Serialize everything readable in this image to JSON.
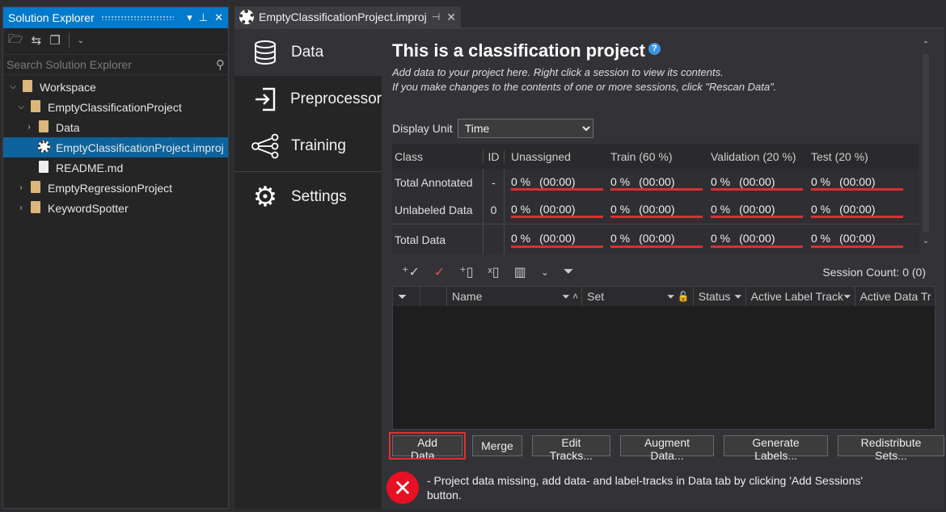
{
  "solution_explorer": {
    "title": "Solution Explorer",
    "search_placeholder": "Search Solution Explorer",
    "tree": [
      {
        "label": "Workspace",
        "depth": 0,
        "expanded": true,
        "kind": "folder"
      },
      {
        "label": "EmptyClassificationProject",
        "depth": 1,
        "expanded": true,
        "kind": "folder"
      },
      {
        "label": "Data",
        "depth": 2,
        "expanded": false,
        "kind": "folder"
      },
      {
        "label": "EmptyClassificationProject.improj",
        "depth": 2,
        "kind": "project",
        "selected": true
      },
      {
        "label": "README.md",
        "depth": 2,
        "kind": "file"
      },
      {
        "label": "EmptyRegressionProject",
        "depth": 1,
        "expanded": false,
        "kind": "folder"
      },
      {
        "label": "KeywordSpotter",
        "depth": 1,
        "expanded": false,
        "kind": "folder"
      }
    ]
  },
  "doc_tab": {
    "label": "EmptyClassificationProject.improj"
  },
  "nav": {
    "items": [
      {
        "label": "Data",
        "icon": "database-icon",
        "active": true
      },
      {
        "label": "Preprocessor",
        "icon": "import-icon"
      },
      {
        "label": "Training",
        "icon": "neural-network-icon"
      },
      {
        "label": "Settings",
        "icon": "gear-icon"
      }
    ]
  },
  "main": {
    "title": "This is a classification project",
    "desc1": "Add data to your project here. Right click a session to view its contents.",
    "desc2": "If you make changes to the contents of one or more sessions, click \"Rescan Data\".",
    "display_unit_label": "Display Unit",
    "display_unit_value": "Time"
  },
  "summary": {
    "headers": [
      "Class",
      "ID",
      "Unassigned",
      "Train (60 %)",
      "Validation (20 %)",
      "Test (20 %)"
    ],
    "rows": [
      {
        "class": "Total Annotated",
        "id": "-",
        "cells": [
          [
            "0 %",
            "(00:00)"
          ],
          [
            "0 %",
            "(00:00)"
          ],
          [
            "0 %",
            "(00:00)"
          ],
          [
            "0 %",
            "(00:00)"
          ]
        ]
      },
      {
        "class": "Unlabeled Data",
        "id": "0",
        "cells": [
          [
            "0 %",
            "(00:00)"
          ],
          [
            "0 %",
            "(00:00)"
          ],
          [
            "0 %",
            "(00:00)"
          ],
          [
            "0 %",
            "(00:00)"
          ]
        ]
      },
      {
        "class": "Total Data",
        "id": "",
        "cells": [
          [
            "0 %",
            "(00:00)"
          ],
          [
            "0 %",
            "(00:00)"
          ],
          [
            "0 %",
            "(00:00)"
          ],
          [
            "0 %",
            "(00:00)"
          ]
        ]
      }
    ]
  },
  "grid": {
    "session_count": "Session Count: 0 (0)",
    "headers": [
      "Name",
      "Set",
      "Status",
      "Active Label Track",
      "Active Data Tr"
    ]
  },
  "buttons": [
    "Add Data...",
    "Merge",
    "Edit Tracks...",
    "Augment Data...",
    "Generate Labels...",
    "Redistribute Sets..."
  ],
  "error": {
    "message": "- Project data missing, add data- and label-tracks in Data tab by clicking 'Add Sessions' button."
  },
  "colors": {
    "accent": "#007acc",
    "error": "#e81123",
    "bar": "#d93030"
  }
}
